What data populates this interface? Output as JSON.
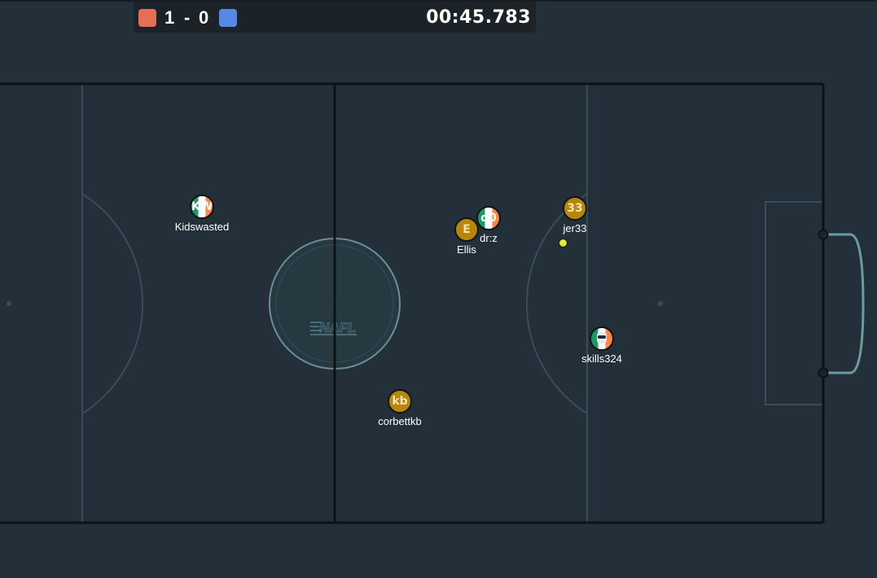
{
  "scoreboard": {
    "red_color": "#e56e56",
    "blue_color": "#5689e5",
    "red_score": "1",
    "separator": "-",
    "blue_score": "0",
    "timer": "00:45.783"
  },
  "pitch": {
    "logo_text": "NAFL",
    "colors": {
      "background": "#233039",
      "boundary": "#0d1215",
      "markings": "#3a4d57",
      "center_circle": "#6b8e97",
      "goal": "#6b9ba1"
    }
  },
  "players": [
    {
      "name": "Kidswasted",
      "avatar": "KW",
      "style": "irish"
    },
    {
      "name": "dr:z",
      "avatar": "d0",
      "style": "irish"
    },
    {
      "name": "Ellis",
      "avatar": "E",
      "style": "gold"
    },
    {
      "name": "jer33",
      "avatar": "33",
      "style": "gold"
    },
    {
      "name": "skills324",
      "avatar": "robot",
      "style": "irish"
    },
    {
      "name": "corbettkb",
      "avatar": "kb",
      "style": "gold"
    }
  ],
  "ball": {
    "color": "#e8e82a"
  }
}
